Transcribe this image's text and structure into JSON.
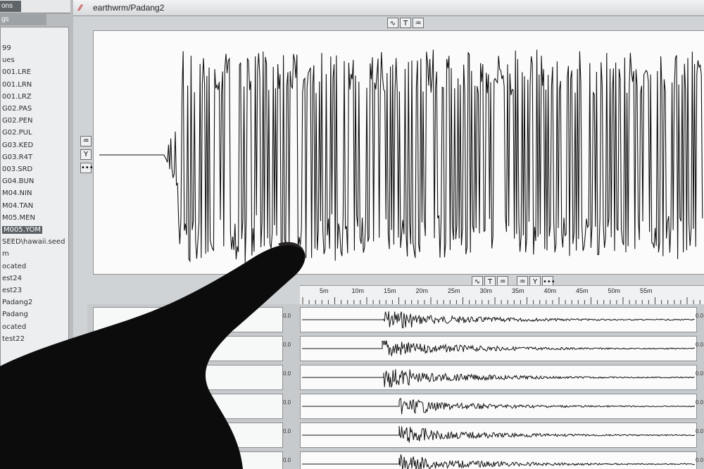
{
  "left_panel": {
    "tab_label": "ons",
    "header_label": "gs",
    "items": [
      {
        "label": "99",
        "selected": false
      },
      {
        "label": "ues",
        "selected": false
      },
      {
        "label": "001.LRE",
        "selected": false
      },
      {
        "label": "001.LRN",
        "selected": false
      },
      {
        "label": "001.LRZ",
        "selected": false
      },
      {
        "label": "G02.PAS",
        "selected": false
      },
      {
        "label": "G02.PEN",
        "selected": false
      },
      {
        "label": "G02.PUL",
        "selected": false
      },
      {
        "label": "G03.KED",
        "selected": false
      },
      {
        "label": "G03.R4T",
        "selected": false
      },
      {
        "label": "003.SRD",
        "selected": false
      },
      {
        "label": "G04.BUN",
        "selected": false
      },
      {
        "label": "M04.NIN",
        "selected": false
      },
      {
        "label": "M04.TAN",
        "selected": false
      },
      {
        "label": "M05.MEN",
        "selected": false
      },
      {
        "label": "M005.YOM",
        "selected": true
      },
      {
        "label": "SEED\\hawaii.seed",
        "selected": false
      },
      {
        "label": "m",
        "selected": false
      },
      {
        "label": "ocated",
        "selected": false
      },
      {
        "label": "est24",
        "selected": false
      },
      {
        "label": "est23",
        "selected": false
      },
      {
        "label": "Padang2",
        "selected": false
      },
      {
        "label": "Padang",
        "selected": false
      },
      {
        "label": "ocated",
        "selected": false
      },
      {
        "label": "test22",
        "selected": false
      }
    ]
  },
  "window": {
    "title": "earthwrm/Padang2",
    "toolbar_top": [
      "∿",
      "T",
      "♒"
    ],
    "toolbar_mid": [
      "∿",
      "T",
      "♒",
      "♒",
      "Y",
      "•••"
    ],
    "side_buttons": [
      "♒",
      "Y",
      "•••"
    ],
    "trace_side_buttons": [
      "♒",
      "Y"
    ]
  },
  "time_axis": {
    "labels": [
      "5m",
      "10m",
      "15m",
      "20m",
      "25m",
      "30m",
      "35m",
      "40m",
      "45m",
      "50m",
      "55m"
    ]
  },
  "traces": {
    "scale_label": "0.0",
    "count": 6
  },
  "colors": {
    "waveform": "#111111",
    "plot_background": "#fbfbfb",
    "title_icon": "#c63737"
  }
}
